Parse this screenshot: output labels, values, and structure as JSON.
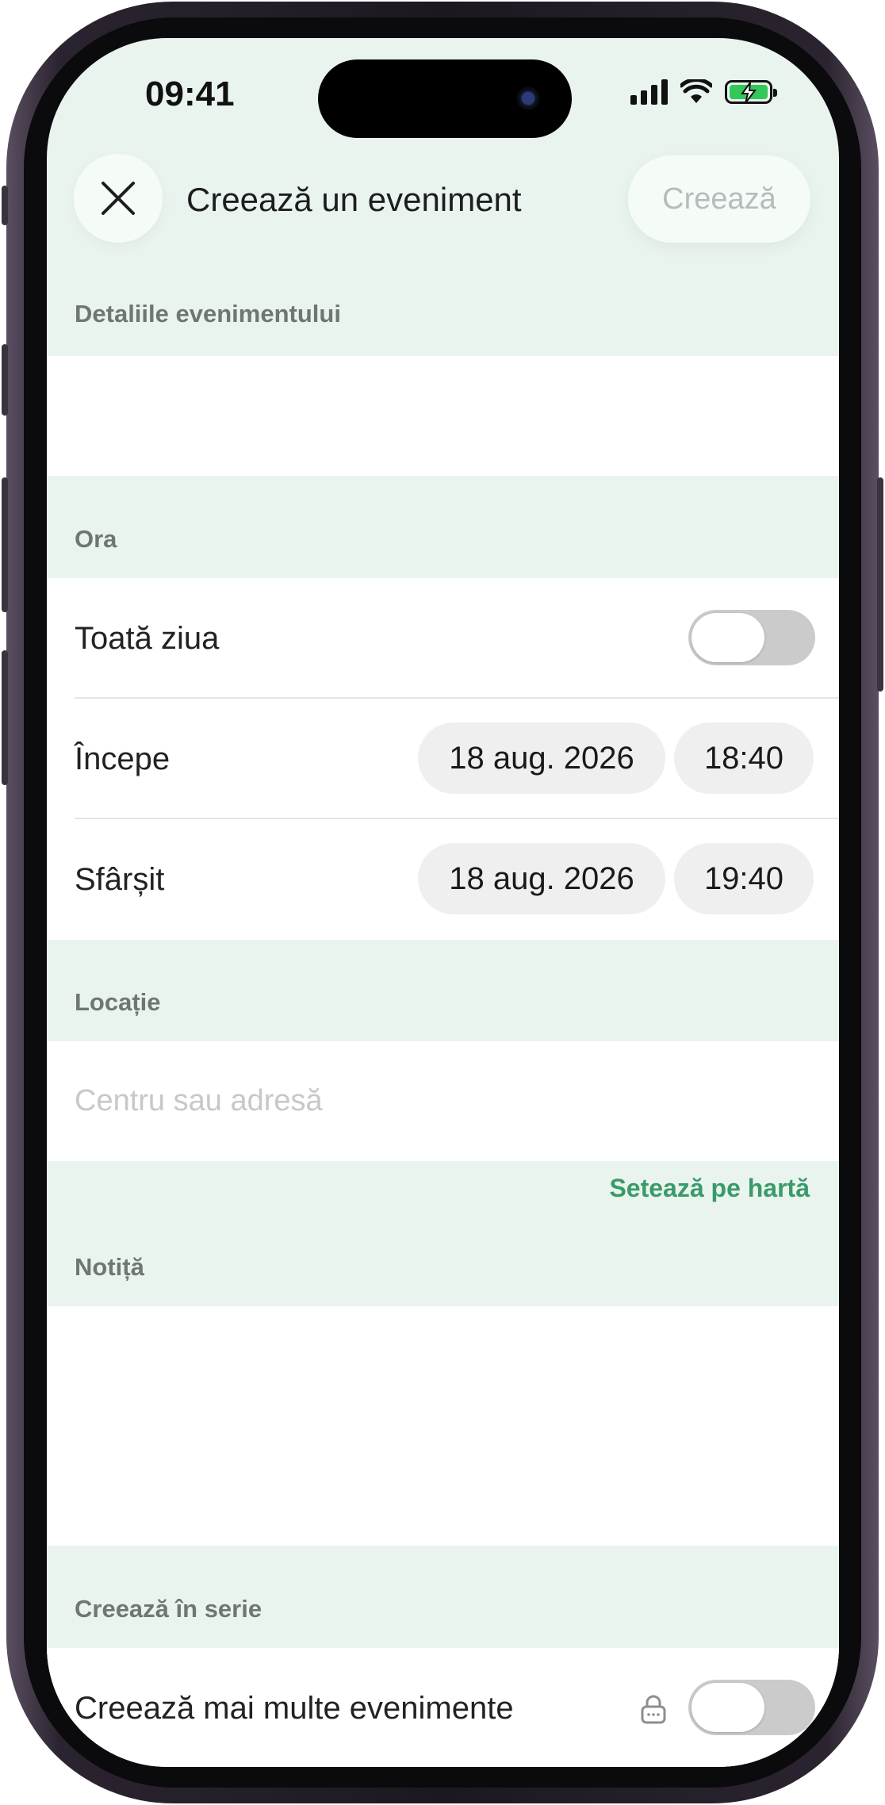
{
  "status_bar": {
    "time": "09:41"
  },
  "header": {
    "title": "Creează un eveniment",
    "create_label": "Creează"
  },
  "sections": {
    "details_label": "Detaliile evenimentului",
    "time_label": "Ora",
    "location_label": "Locație",
    "note_label": "Notiță",
    "series_label": "Creează în serie"
  },
  "time": {
    "all_day_label": "Toată ziua",
    "all_day_on": false,
    "start_label": "Începe",
    "start_date": "18 aug. 2026",
    "start_time": "18:40",
    "end_label": "Sfârșit",
    "end_date": "18 aug. 2026",
    "end_time": "19:40"
  },
  "location": {
    "placeholder": "Centru sau adresă",
    "map_link": "Setează pe hartă"
  },
  "series": {
    "multiple_label": "Creează mai multe evenimente",
    "multiple_on": false
  },
  "colors": {
    "background_tint": "#eaf4ee",
    "accent_green": "#3a9a6a",
    "battery_green": "#34c759"
  },
  "icons": [
    "close-icon",
    "signal-icon",
    "wifi-icon",
    "battery-charging-icon",
    "lock-icon"
  ]
}
